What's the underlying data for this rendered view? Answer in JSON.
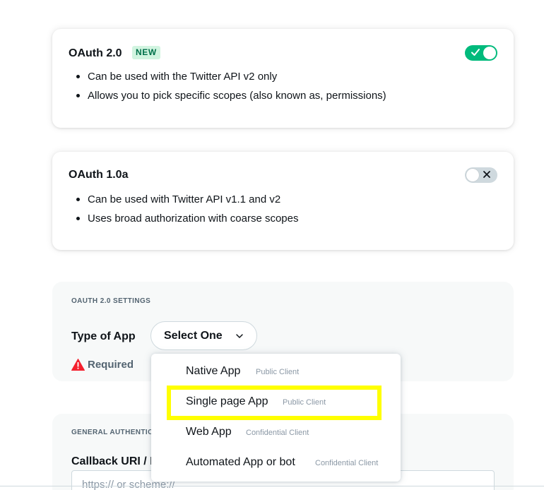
{
  "oauth2": {
    "title": "OAuth 2.0",
    "badge": "NEW",
    "enabled": true,
    "bullets": [
      "Can be used with the Twitter API v2 only",
      "Allows you to pick specific scopes (also known as, permissions)"
    ]
  },
  "oauth1": {
    "title": "OAuth 1.0a",
    "enabled": false,
    "bullets": [
      "Can be used with Twitter API v1.1 and v2",
      "Uses broad authorization with coarse scopes"
    ]
  },
  "settings": {
    "section_label": "OAUTH 2.0 SETTINGS",
    "type_label": "Type of App",
    "select_label": "Select One",
    "required_text": "Required"
  },
  "dropdown": {
    "options": [
      {
        "label": "Native App",
        "sub": "Public Client"
      },
      {
        "label": "Single page App",
        "sub": "Public Client"
      },
      {
        "label": "Web App",
        "sub": "Confidential Client"
      },
      {
        "label": "Automated App or bot",
        "sub": "Confidential Client"
      }
    ],
    "highlighted_index": 1
  },
  "general": {
    "section_label": "GENERAL AUTHENTICATION SETTINGS",
    "callback_label": "Callback URI / Redirect URL",
    "callback_placeholder": "https:// or scheme://"
  },
  "colors": {
    "toggle_on": "#00ba7c",
    "toggle_off": "#cfd9de",
    "badge_bg": "#d1f4e0",
    "warning": "#f4212e",
    "highlight": "#ffff00"
  },
  "icons": {
    "toggle_on": "check-icon",
    "toggle_off": "x-icon",
    "select": "chevron-down-icon",
    "required": "warning-triangle-icon"
  }
}
